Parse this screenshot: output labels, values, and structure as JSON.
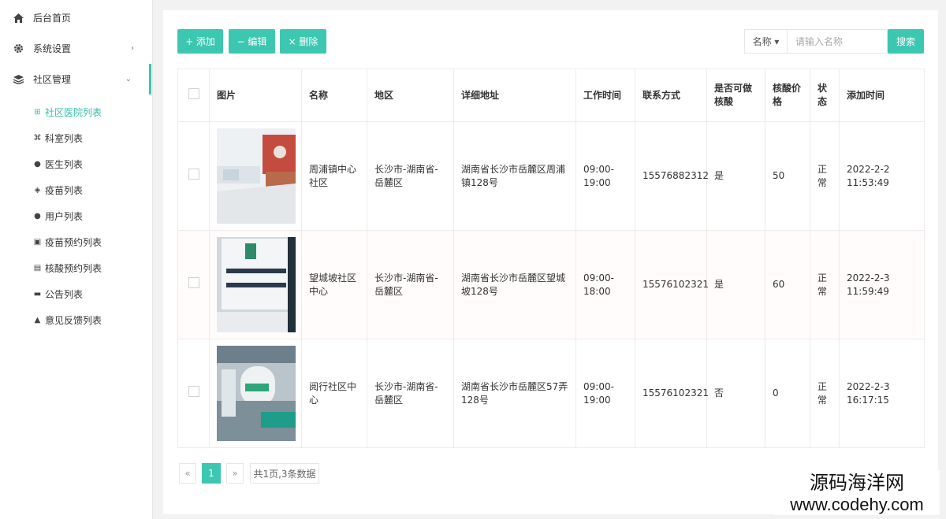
{
  "sidebar": {
    "items": [
      {
        "label": "后台首页",
        "icon": "home-icon"
      },
      {
        "label": "系统设置",
        "icon": "gear-icon",
        "arrow": "›"
      },
      {
        "label": "社区管理",
        "icon": "layers-icon",
        "arrow": "⌄"
      }
    ],
    "sub_items": [
      {
        "label": "社区医院列表",
        "icon": "plus-square-icon",
        "glyph": "⊞"
      },
      {
        "label": "科室列表",
        "icon": "command-icon",
        "glyph": "⌘"
      },
      {
        "label": "医生列表",
        "icon": "user-circle-icon",
        "glyph": "●"
      },
      {
        "label": "疫苗列表",
        "icon": "pill-icon",
        "glyph": "◈"
      },
      {
        "label": "用户列表",
        "icon": "user-circle-icon",
        "glyph": "●"
      },
      {
        "label": "疫苗预约列表",
        "icon": "list-box-icon",
        "glyph": "▣"
      },
      {
        "label": "核酸预约列表",
        "icon": "id-card-icon",
        "glyph": "▤"
      },
      {
        "label": "公告列表",
        "icon": "notice-icon",
        "glyph": "▬"
      },
      {
        "label": "意见反馈列表",
        "icon": "warning-icon",
        "glyph": "▲"
      }
    ]
  },
  "toolbar": {
    "add_label": "+ 添加",
    "edit_label": "− 编辑",
    "delete_label": "× 删除",
    "search_field": "名称 ▾",
    "search_placeholder": "请输入名称",
    "search_button": "搜索"
  },
  "table": {
    "headers": [
      "图片",
      "名称",
      "地区",
      "详细地址",
      "工作时间",
      "联系方式",
      "是否可做核酸",
      "核酸价格",
      "状态",
      "添加时间"
    ],
    "rows": [
      {
        "name": "周浦镇中心社区",
        "region": "长沙市-湖南省-岳麓区",
        "address": "湖南省长沙市岳麓区周浦镇128号",
        "hours": "09:00-19:00",
        "phone": "15576882312",
        "nucleic": "是",
        "price": "50",
        "status": "正常",
        "added": "2022-2-2 11:53:49"
      },
      {
        "name": "望城坡社区中心",
        "region": "长沙市-湖南省-岳麓区",
        "address": "湖南省长沙市岳麓区望城坡128号",
        "hours": "09:00-18:00",
        "phone": "15576102321",
        "nucleic": "是",
        "price": "60",
        "status": "正常",
        "added": "2022-2-3 11:59:49"
      },
      {
        "name": "阅行社区中心",
        "region": "长沙市-湖南省-岳麓区",
        "address": "湖南省长沙市岳麓区57弄128号",
        "hours": "09:00-19:00",
        "phone": "15576102321",
        "nucleic": "否",
        "price": "0",
        "status": "正常",
        "added": "2022-2-3 16:17:15"
      }
    ]
  },
  "pagination": {
    "prev": "«",
    "current": "1",
    "next": "»",
    "summary": "共1页,3条数据"
  },
  "watermark": {
    "line1": "源码海洋网",
    "line2": "www.codehy.com"
  },
  "colors": {
    "accent": "#3cc7b0",
    "green_text": "#2fbfa6",
    "orange_text": "#f0a03c"
  }
}
